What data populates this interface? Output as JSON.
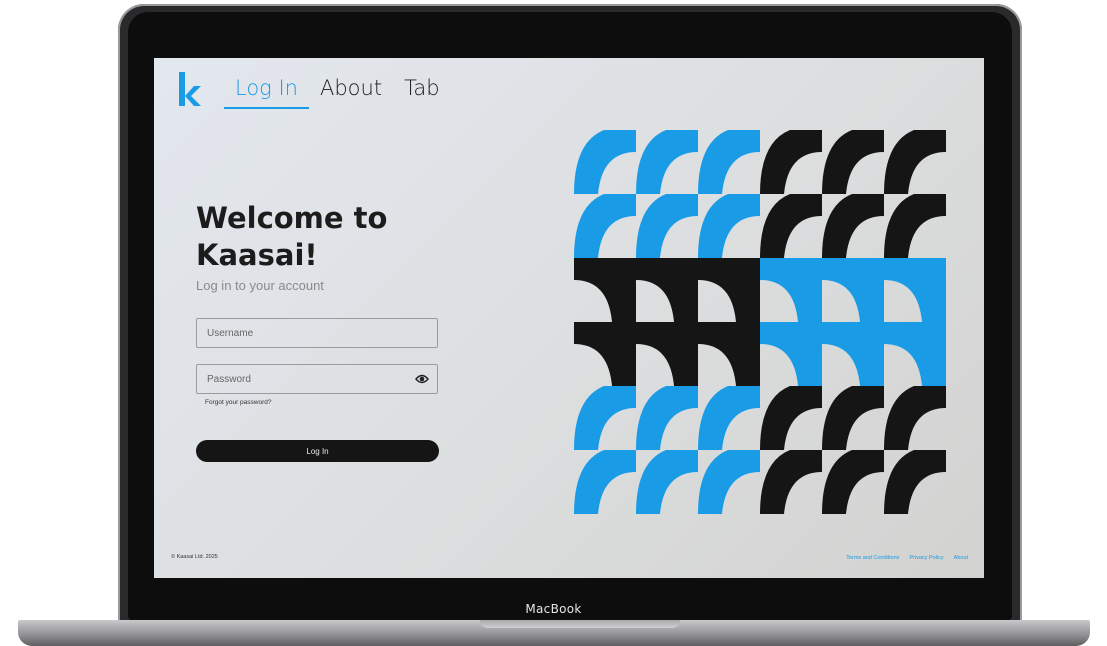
{
  "device": {
    "label": "MacBook"
  },
  "nav": {
    "tabs": [
      {
        "label": "Log In",
        "active": true
      },
      {
        "label": "About"
      },
      {
        "label": "Tab"
      }
    ]
  },
  "hero": {
    "title_line1": "Welcome to",
    "title_line2": "Kaasai!",
    "subtitle": "Log in to your account"
  },
  "form": {
    "username_placeholder": "Username",
    "password_placeholder": "Password",
    "forgot_label": "Forgot your password?",
    "submit_label": "Log In"
  },
  "footer": {
    "copyright": "© Kaasai Ltd. 2025",
    "links": [
      "Terms and Conditions",
      "Privacy Policy",
      "About"
    ]
  },
  "colors": {
    "accent": "#1a9be6",
    "dark": "#151515"
  },
  "icons": {
    "password_toggle": "eye-icon",
    "logo": "kaasai-logo"
  }
}
